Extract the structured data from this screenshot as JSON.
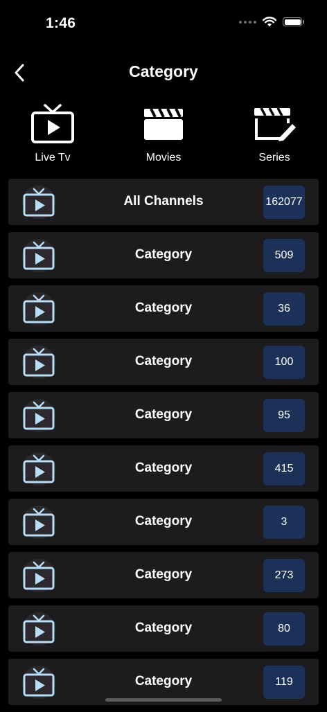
{
  "status_bar": {
    "time": "1:46"
  },
  "header": {
    "title": "Category"
  },
  "type_tabs": [
    {
      "label": "Live Tv",
      "icon": "tv-play-icon"
    },
    {
      "label": "Movies",
      "icon": "clapperboard-icon"
    },
    {
      "label": "Series",
      "icon": "clapperboard-edit-icon"
    }
  ],
  "categories": [
    {
      "label": "All Channels",
      "count": "162077"
    },
    {
      "label": "Category",
      "count": "509"
    },
    {
      "label": "Category",
      "count": "36"
    },
    {
      "label": "Category",
      "count": "100"
    },
    {
      "label": "Category",
      "count": "95"
    },
    {
      "label": "Category",
      "count": "415"
    },
    {
      "label": "Category",
      "count": "3"
    },
    {
      "label": "Category",
      "count": "273"
    },
    {
      "label": "Category",
      "count": "80"
    },
    {
      "label": "Category",
      "count": "119"
    }
  ],
  "colors": {
    "background": "#000000",
    "row_background": "#1c1c1e",
    "count_badge": "#1c3158",
    "row_icon": "#b9dcf7"
  }
}
